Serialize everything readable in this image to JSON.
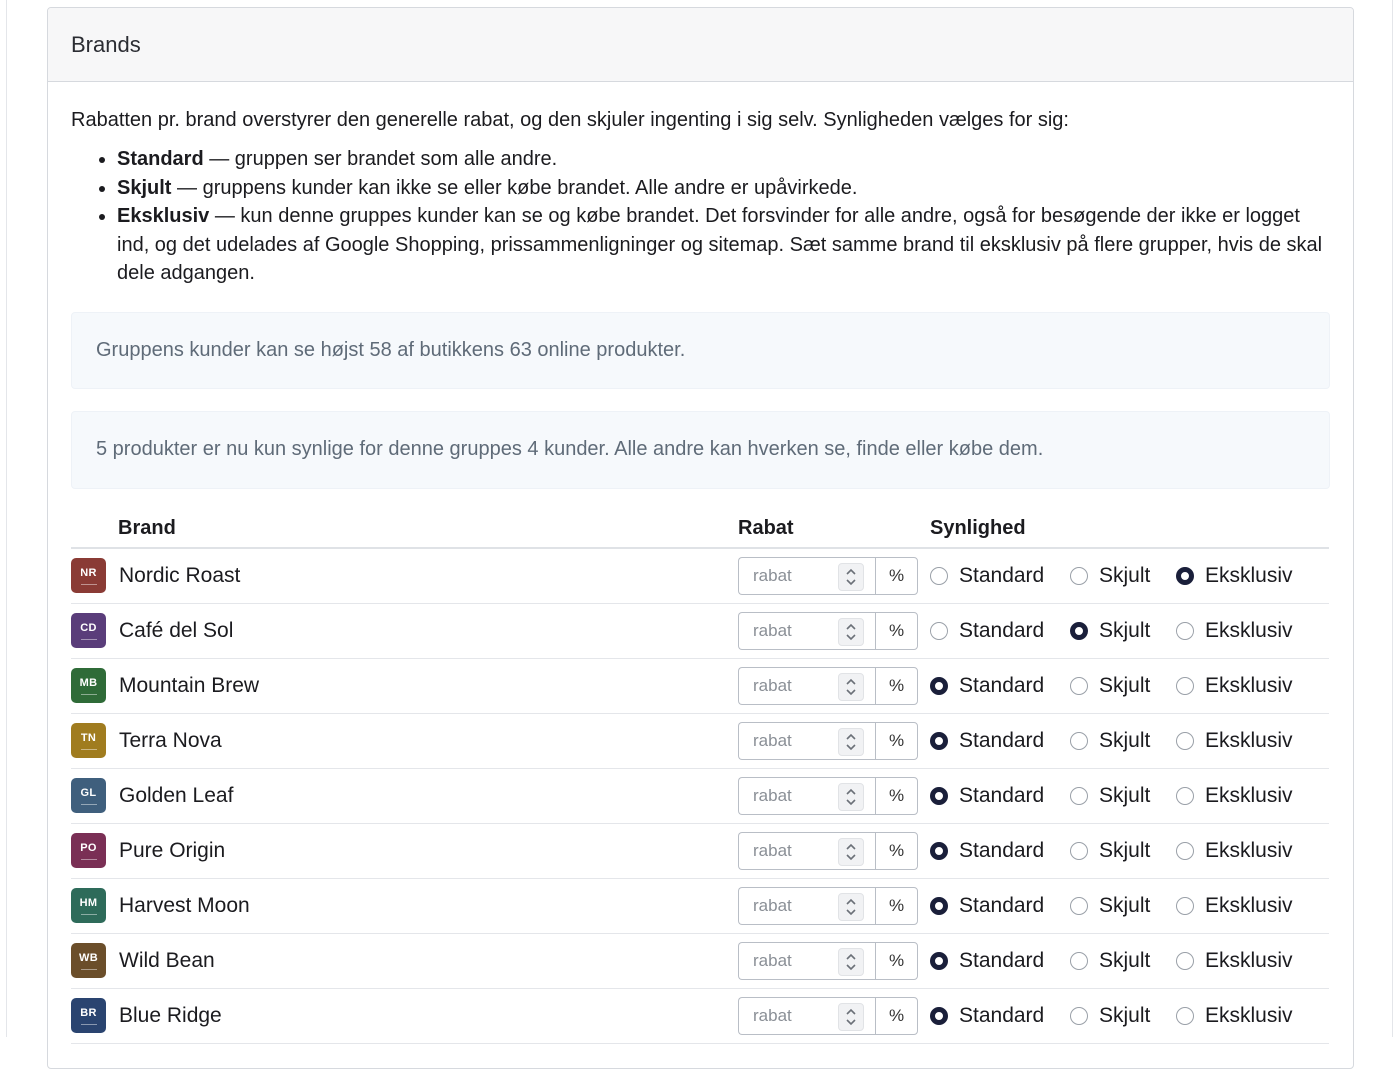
{
  "card": {
    "title": "Brands",
    "intro": "Rabatten pr. brand overstyrer den generelle rabat, og den skjuler ingenting i sig selv. Synligheden vælges for sig:",
    "bullets": [
      {
        "term": "Standard",
        "text": " — gruppen ser brandet som alle andre."
      },
      {
        "term": "Skjult",
        "text": " — gruppens kunder kan ikke se eller købe brandet. Alle andre er upåvirkede."
      },
      {
        "term": "Eksklusiv",
        "text": " — kun denne gruppes kunder kan se og købe brandet. Det forsvinder for alle andre, også for besøgende der ikke er logget ind, og det udelades af Google Shopping, prissammenligninger og sitemap. Sæt samme brand til eksklusiv på flere grupper, hvis de skal dele adgangen."
      }
    ],
    "alert_visibility": "Gruppens kunder kan se højst 58 af butikkens 63 online produkter.",
    "alert_exclusive": "5 produkter er nu kun synlige for denne gruppes 4 kunder. Alle andre kan hverken se, finde eller købe dem."
  },
  "table": {
    "headers": {
      "brand": "Brand",
      "rabat": "Rabat",
      "synlighed": "Synlighed"
    },
    "rabat_placeholder": "rabat",
    "percent": "%",
    "options": [
      "Standard",
      "Skjult",
      "Eksklusiv"
    ],
    "rows": [
      {
        "initials": "NR",
        "name": "Nordic Roast",
        "color": "#8a3b35",
        "visibility": "Eksklusiv"
      },
      {
        "initials": "CD",
        "name": "Café del Sol",
        "color": "#5a3d7a",
        "visibility": "Skjult"
      },
      {
        "initials": "MB",
        "name": "Mountain Brew",
        "color": "#2f6b38",
        "visibility": "Standard"
      },
      {
        "initials": "TN",
        "name": "Terra Nova",
        "color": "#a07c1f",
        "visibility": "Standard"
      },
      {
        "initials": "GL",
        "name": "Golden Leaf",
        "color": "#3f5f7d",
        "visibility": "Standard"
      },
      {
        "initials": "PO",
        "name": "Pure Origin",
        "color": "#7a2f55",
        "visibility": "Standard"
      },
      {
        "initials": "HM",
        "name": "Harvest Moon",
        "color": "#2e6b5a",
        "visibility": "Standard"
      },
      {
        "initials": "WB",
        "name": "Wild Bean",
        "color": "#6b4e2a",
        "visibility": "Standard"
      },
      {
        "initials": "BR",
        "name": "Blue Ridge",
        "color": "#2a4470",
        "visibility": "Standard"
      }
    ]
  }
}
